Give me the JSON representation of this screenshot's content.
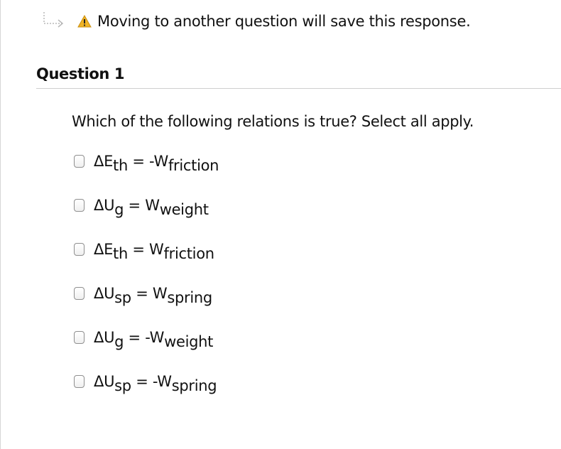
{
  "notice": {
    "text": "Moving to another question will save this response.",
    "icons": [
      "return-arrow-icon",
      "warning-icon"
    ]
  },
  "question": {
    "heading": "Question 1",
    "prompt": "Which of the following relations is true? Select all apply."
  },
  "options": [
    {
      "lhs": "ΔE",
      "lhs_sub": "th",
      "middle": " = -W",
      "rhs_sub": "friction"
    },
    {
      "lhs": "ΔU",
      "lhs_sub": "g",
      "middle": " = W",
      "rhs_sub": "weight"
    },
    {
      "lhs": "ΔE",
      "lhs_sub": "th",
      "middle": " = W",
      "rhs_sub": "friction"
    },
    {
      "lhs": "ΔU",
      "lhs_sub": "sp",
      "middle": " = W",
      "rhs_sub": "spring"
    },
    {
      "lhs": "ΔU",
      "lhs_sub": "g",
      "middle": " = -W",
      "rhs_sub": "weight"
    },
    {
      "lhs": "ΔU",
      "lhs_sub": "sp",
      "middle": " = -W",
      "rhs_sub": "spring"
    }
  ],
  "colors": {
    "warning": "#f0b323",
    "rule": "#cfcfcf",
    "arrow": "#b8b8b8"
  }
}
